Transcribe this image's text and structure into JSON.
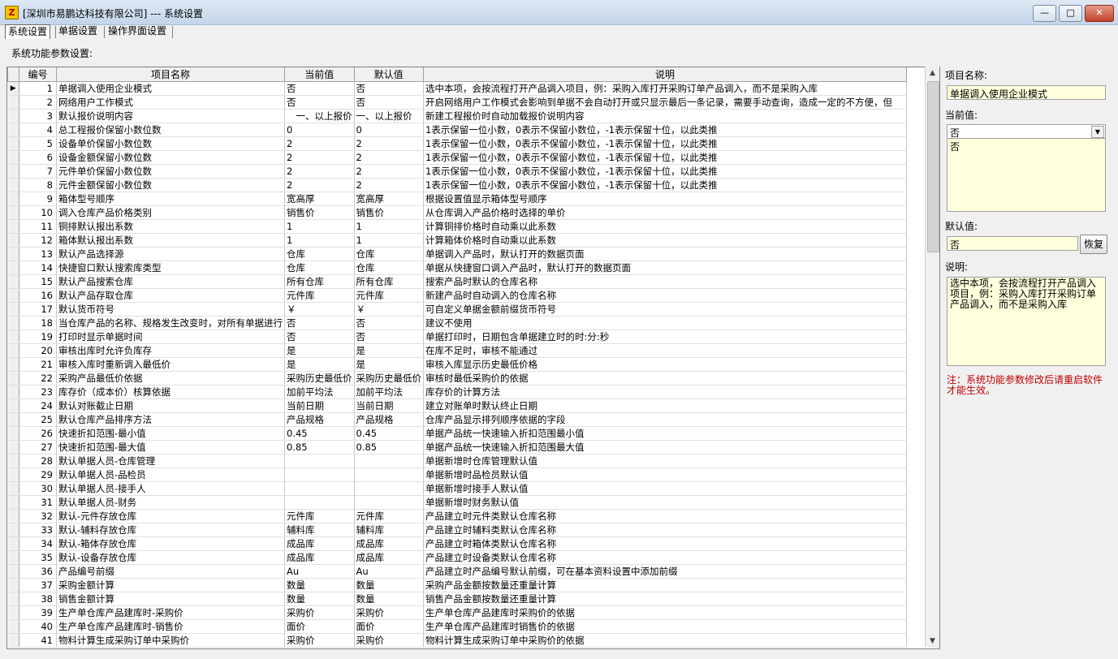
{
  "window": {
    "title": "[深圳市易鹏达科技有限公司] --- 系统设置",
    "minimize": "—",
    "maximize": "□",
    "close": "✕"
  },
  "tabs": [
    "系统设置",
    "单据设置",
    "操作界面设置"
  ],
  "section_label": "系统功能参数设置:",
  "table": {
    "columns": [
      "编号",
      "项目名称",
      "当前值",
      "默认值",
      "说明"
    ],
    "rows": [
      [
        "1",
        "单据调入使用企业模式",
        "否",
        "否",
        "选中本项，会按流程打开产品调入项目，例：采购入库打开采购订单产品调入，而不是采购入库"
      ],
      [
        "2",
        "网络用户工作模式",
        "否",
        "否",
        "开启网络用户工作模式会影响到单据不会自动打开或只显示最后一条记录，需要手动查询，造成一定的不方便，但"
      ],
      [
        "3",
        "默认报价说明内容",
        "　一、以上报价",
        "一、以上报价",
        "新建工程报价时自动加载报价说明内容"
      ],
      [
        "4",
        "总工程报价保留小数位数",
        "0",
        "0",
        "1表示保留一位小数，0表示不保留小数位，-1表示保留十位，以此类推"
      ],
      [
        "5",
        "设备单价保留小数位数",
        "2",
        "2",
        "1表示保留一位小数，0表示不保留小数位，-1表示保留十位，以此类推"
      ],
      [
        "6",
        "设备金额保留小数位数",
        "2",
        "2",
        "1表示保留一位小数，0表示不保留小数位，-1表示保留十位，以此类推"
      ],
      [
        "7",
        "元件单价保留小数位数",
        "2",
        "2",
        "1表示保留一位小数，0表示不保留小数位，-1表示保留十位，以此类推"
      ],
      [
        "8",
        "元件金额保留小数位数",
        "2",
        "2",
        "1表示保留一位小数，0表示不保留小数位，-1表示保留十位，以此类推"
      ],
      [
        "9",
        "箱体型号顺序",
        "宽高厚",
        "宽高厚",
        "根据设置值显示箱体型号顺序"
      ],
      [
        "10",
        "调入仓库产品价格类别",
        "销售价",
        "销售价",
        "从仓库调入产品价格时选择的单价"
      ],
      [
        "11",
        "铜排默认报出系数",
        "1",
        "1",
        "计算铜排价格时自动乘以此系数"
      ],
      [
        "12",
        "箱体默认报出系数",
        "1",
        "1",
        "计算箱体价格时自动乘以此系数"
      ],
      [
        "13",
        "默认产品选择源",
        "仓库",
        "仓库",
        "单据调入产品时，默认打开的数据页面"
      ],
      [
        "14",
        "快捷窗口默认搜索库类型",
        "仓库",
        "仓库",
        "单据从快捷窗口调入产品时，默认打开的数据页面"
      ],
      [
        "15",
        "默认产品搜索仓库",
        "所有仓库",
        "所有仓库",
        "搜索产品时默认的仓库名称"
      ],
      [
        "16",
        "默认产品存取仓库",
        "元件库",
        "元件库",
        "新建产品时自动调入的仓库名称"
      ],
      [
        "17",
        "默认货币符号",
        "￥",
        "￥",
        "可自定义单据金额前缀货币符号"
      ],
      [
        "18",
        "当仓库产品的名称、规格发生改变时，对所有单据进行",
        "否",
        "否",
        "建议不使用"
      ],
      [
        "19",
        "打印时显示单据时间",
        "否",
        "否",
        "单据打印时，日期包含单据建立时的时:分:秒"
      ],
      [
        "20",
        "审核出库时允许负库存",
        "是",
        "是",
        "在库不足时，审核不能通过"
      ],
      [
        "21",
        "审核入库时重新调入最低价",
        "是",
        "是",
        "审核入库显示历史最低价格"
      ],
      [
        "22",
        "采购产品最低价依据",
        "采购历史最低价",
        "采购历史最低价",
        "审核时最低采购价的依据"
      ],
      [
        "23",
        "库存价（成本价）核算依据",
        "加前平均法",
        "加前平均法",
        "库存价的计算方法"
      ],
      [
        "24",
        "默认对账截止日期",
        "当前日期",
        "当前日期",
        "建立对账单时默认终止日期"
      ],
      [
        "25",
        "默认仓库产品排序方法",
        "产品规格",
        "产品规格",
        "仓库产品显示排列顺序依据的字段"
      ],
      [
        "26",
        "快速折扣范围-最小值",
        "0.45",
        "0.45",
        "单据产品统一快速输入折扣范围最小值"
      ],
      [
        "27",
        "快速折扣范围-最大值",
        "0.85",
        "0.85",
        "单据产品统一快速输入折扣范围最大值"
      ],
      [
        "28",
        "默认单据人员-仓库管理",
        "",
        "",
        "单据新增时仓库管理默认值"
      ],
      [
        "29",
        "默认单据人员-品检员",
        "",
        "",
        "单据新增时品检员默认值"
      ],
      [
        "30",
        "默认单据人员-接手人",
        "",
        "",
        "单据新增时接手人默认值"
      ],
      [
        "31",
        "默认单据人员-财务",
        "",
        "",
        "单据新增时财务默认值"
      ],
      [
        "32",
        "默认-元件存放仓库",
        "元件库",
        "元件库",
        "产品建立时元件类默认仓库名称"
      ],
      [
        "33",
        "默认-辅料存放仓库",
        "辅料库",
        "辅料库",
        "产品建立时辅料类默认仓库名称"
      ],
      [
        "34",
        "默认-箱体存放仓库",
        "成品库",
        "成品库",
        "产品建立时箱体类默认仓库名称"
      ],
      [
        "35",
        "默认-设备存放仓库",
        "成品库",
        "成品库",
        "产品建立时设备类默认仓库名称"
      ],
      [
        "36",
        "产品编号前缀",
        "Au",
        "Au",
        "产品建立时产品编号默认前缀，可在基本资料设置中添加前缀"
      ],
      [
        "37",
        "采购金额计算",
        "数量",
        "数量",
        "采购产品金额按数量还重量计算"
      ],
      [
        "38",
        "销售金额计算",
        "数量",
        "数量",
        "销售产品金额按数量还重量计算"
      ],
      [
        "39",
        "生产单仓库产品建库时-采购价",
        "采购价",
        "采购价",
        "生产单仓库产品建库时采购价的依据"
      ],
      [
        "40",
        "生产单仓库产品建库时-销售价",
        "面价",
        "面价",
        "生产单仓库产品建库时销售价的依据"
      ],
      [
        "41",
        "物料计算生成采购订单中采购价",
        "采购价",
        "采购价",
        "物料计算生成采购订单中采购价的依据"
      ]
    ]
  },
  "side": {
    "name_label": "项目名称:",
    "name_value": "单据调入使用企业模式",
    "current_label": "当前值:",
    "current_value": "否",
    "current_list_item": "否",
    "default_label": "默认值:",
    "default_value": "否",
    "restore_button": "恢复",
    "desc_label": "说明:",
    "desc_value": "选中本项，会按流程打开产品调入项目，例：采购入库打开采购订单产品调入，而不是采购入库",
    "note": "注：系统功能参数修改后请重启软件才能生效。"
  },
  "icons": {
    "app": "app-logo-icon",
    "row_pointer": "row-pointer-icon",
    "scroll_up": "scroll-up-icon",
    "scroll_down": "scroll-down-icon",
    "combo": "chevron-down-icon"
  }
}
